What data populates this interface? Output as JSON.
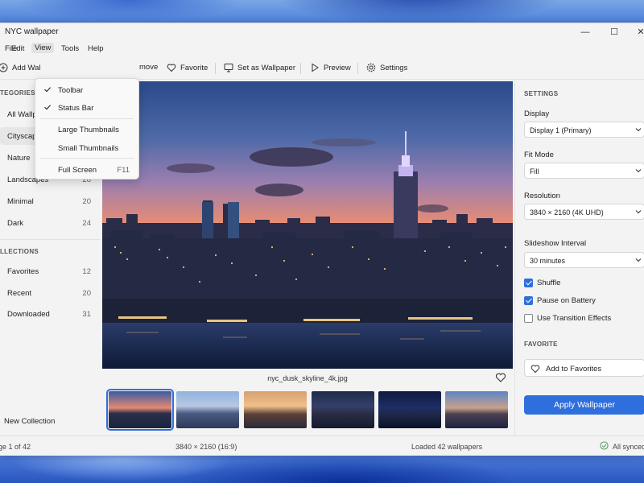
{
  "window": {
    "title": "NYC wallpaper",
    "controls": {
      "minimize": "—",
      "maximize": "☐",
      "close": "✕"
    }
  },
  "menubar": {
    "items": [
      "File",
      "Edit",
      "View",
      "Tools",
      "Help"
    ]
  },
  "toolbar": {
    "add_wallpaper": "Add Wal",
    "remove": "move",
    "favorite": "Favorite",
    "set_as_wallpaper": "Set as Wallpaper",
    "preview": "Preview",
    "settings": "Settings"
  },
  "view_menu": {
    "items": [
      {
        "label": "Toolbar",
        "checked": true,
        "shortcut": ""
      },
      {
        "label": "Status Bar",
        "checked": true,
        "shortcut": ""
      },
      {
        "label": "Large Thumbnails",
        "checked": false,
        "shortcut": ""
      },
      {
        "label": "Small Thumbnails",
        "checked": false,
        "shortcut": ""
      },
      {
        "label": "Full Screen",
        "checked": false,
        "shortcut": "F11"
      }
    ]
  },
  "sidebar": {
    "categories_heading": "TEGORIES",
    "categories": [
      {
        "label": "All Wallp",
        "count": ""
      },
      {
        "label": "Cityscape",
        "count": ""
      },
      {
        "label": "Nature",
        "count": "38"
      },
      {
        "label": "Landscapes",
        "count": "28"
      },
      {
        "label": "Minimal",
        "count": "20"
      },
      {
        "label": "Dark",
        "count": "24"
      }
    ],
    "collections_heading": "LLECTIONS",
    "collections": [
      {
        "label": "Favorites",
        "count": "12"
      },
      {
        "label": "Recent",
        "count": "20"
      },
      {
        "label": "Downloaded",
        "count": "31"
      }
    ],
    "new_collection": "New Collection"
  },
  "preview": {
    "filename": "nyc_dusk_skyline_4k.jpg",
    "thumbnail_count": 6,
    "selected_thumbnail": 0
  },
  "settings": {
    "heading": "SETTINGS",
    "display_label": "Display",
    "display_value": "Display 1 (Primary)",
    "fit_mode_label": "Fit Mode",
    "fit_mode_value": "Fill",
    "resolution_label": "Resolution",
    "resolution_value": "3840 × 2160 (4K UHD)",
    "interval_label": "Slideshow Interval",
    "interval_value": "30 minutes",
    "shuffle_label": "Shuffle",
    "shuffle_checked": true,
    "battery_label": "Pause on Battery",
    "battery_checked": true,
    "transition_label": "Use Transition Effects",
    "transition_checked": false,
    "favorite_heading": "FAVORITE",
    "add_to_favorites": "Add to Favorites",
    "apply_button": "Apply Wallpaper"
  },
  "statusbar": {
    "page": "ge 1 of 42",
    "dimensions": "3840 × 2160 (16:9)",
    "loaded": "Loaded 42 wallpapers",
    "sync": "All synced"
  },
  "colors": {
    "accent": "#2f6fdd",
    "window_bg": "#f3f3f3"
  }
}
